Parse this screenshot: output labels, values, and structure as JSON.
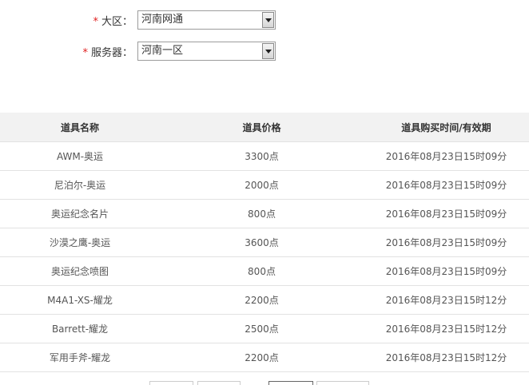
{
  "form": {
    "required_mark": "*",
    "region_label": "大区：",
    "region_value": "河南网通",
    "server_label": "服务器：",
    "server_value": "河南一区"
  },
  "table": {
    "headers": [
      "道具名称",
      "道具价格",
      "道具购买时间/有效期"
    ],
    "rows": [
      {
        "name": "AWM-奥运",
        "price": "3300点",
        "time": "2016年08月23日15时09分"
      },
      {
        "name": "尼泊尔-奥运",
        "price": "2000点",
        "time": "2016年08月23日15时09分"
      },
      {
        "name": "奥运纪念名片",
        "price": "800点",
        "time": "2016年08月23日15时09分"
      },
      {
        "name": "沙漠之鹰-奥运",
        "price": "3600点",
        "time": "2016年08月23日15时09分"
      },
      {
        "name": "奥运纪念喷图",
        "price": "800点",
        "time": "2016年08月23日15时09分"
      },
      {
        "name": "M4A1-XS-耀龙",
        "price": "2200点",
        "time": "2016年08月23日15时12分"
      },
      {
        "name": "Barrett-耀龙",
        "price": "2500点",
        "time": "2016年08月23日15时12分"
      },
      {
        "name": "军用手斧-耀龙",
        "price": "2200点",
        "time": "2016年08月23日15时12分"
      }
    ]
  }
}
